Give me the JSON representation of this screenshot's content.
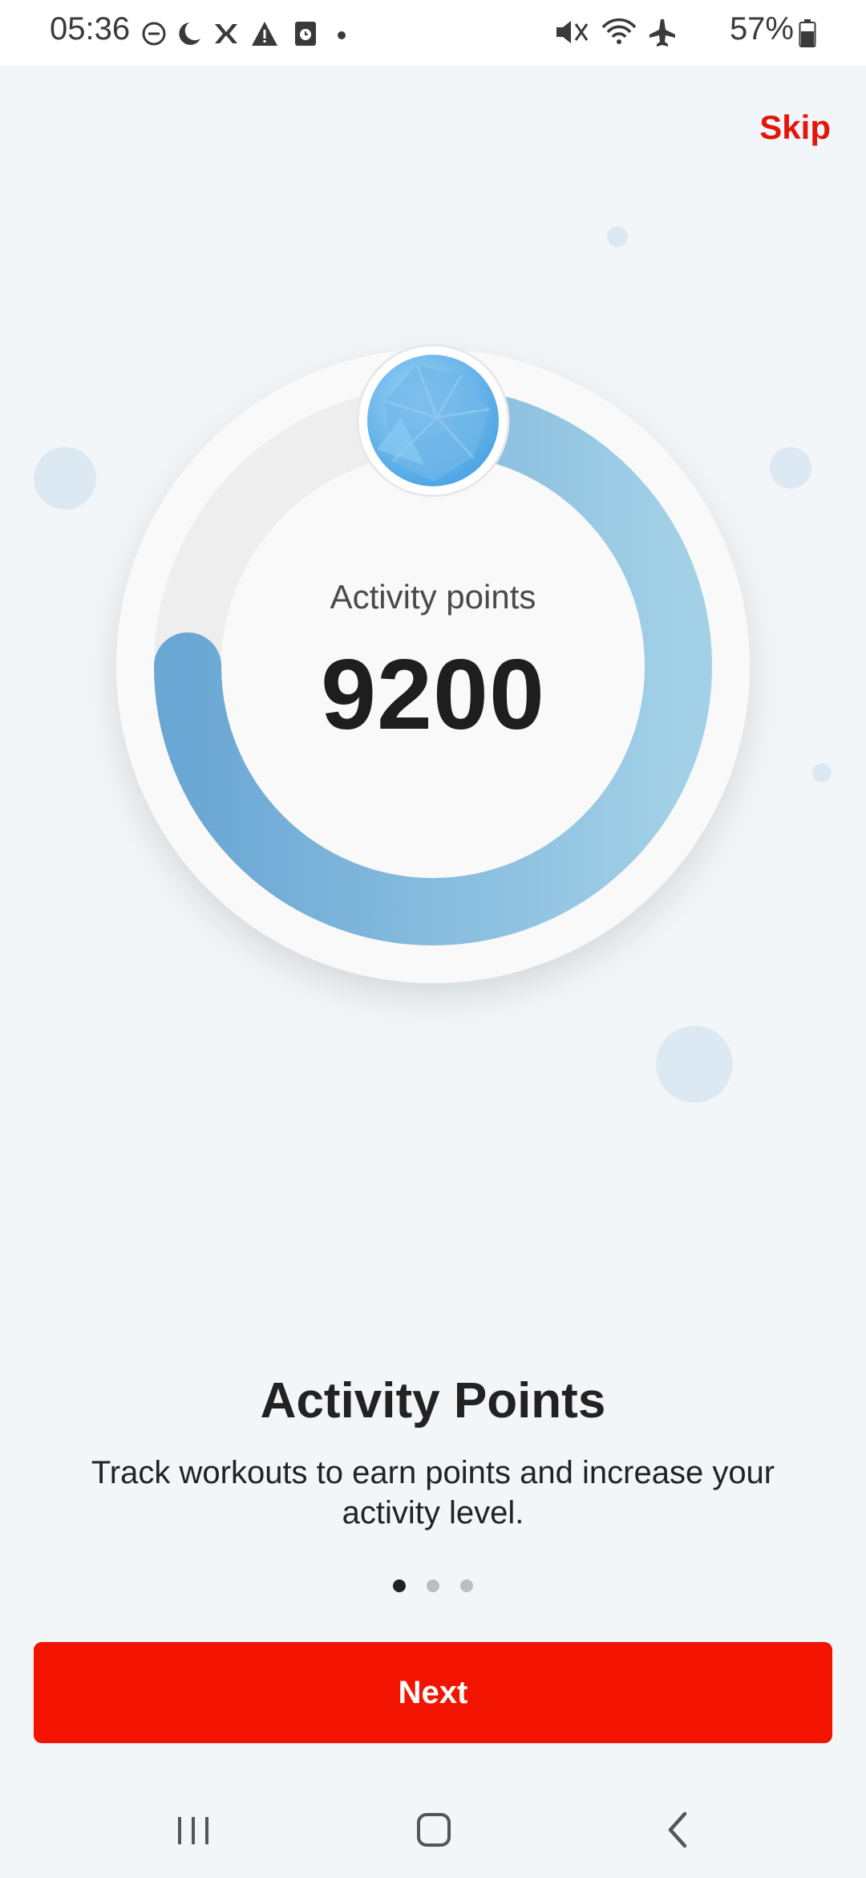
{
  "status_bar": {
    "time": "05:36",
    "battery": "57%",
    "icons_left": [
      "do-not-disturb-icon",
      "moon-icon",
      "ymca-icon",
      "warning-icon",
      "clock-app-icon",
      "dot-icon"
    ],
    "icons_right": [
      "mute-icon",
      "wifi-icon",
      "airplane-icon",
      "battery-icon"
    ]
  },
  "header": {
    "skip_label": "Skip"
  },
  "hero": {
    "label": "Activity points",
    "value": "9200",
    "progress_fraction": 0.75,
    "badge_icon": "blue-gem-icon",
    "colors": {
      "ring_start": "#6aa7d4",
      "ring_end": "#a2d0e7",
      "track": "#eeeeee"
    }
  },
  "content": {
    "title": "Activity Points",
    "description": "Track workouts to earn points and increase your activity level."
  },
  "pager": {
    "count": 3,
    "active_index": 0
  },
  "actions": {
    "next_label": "Next",
    "accent": "#f21300"
  },
  "nav_bar": {
    "icons": [
      "recents-icon",
      "home-icon",
      "back-icon"
    ]
  }
}
